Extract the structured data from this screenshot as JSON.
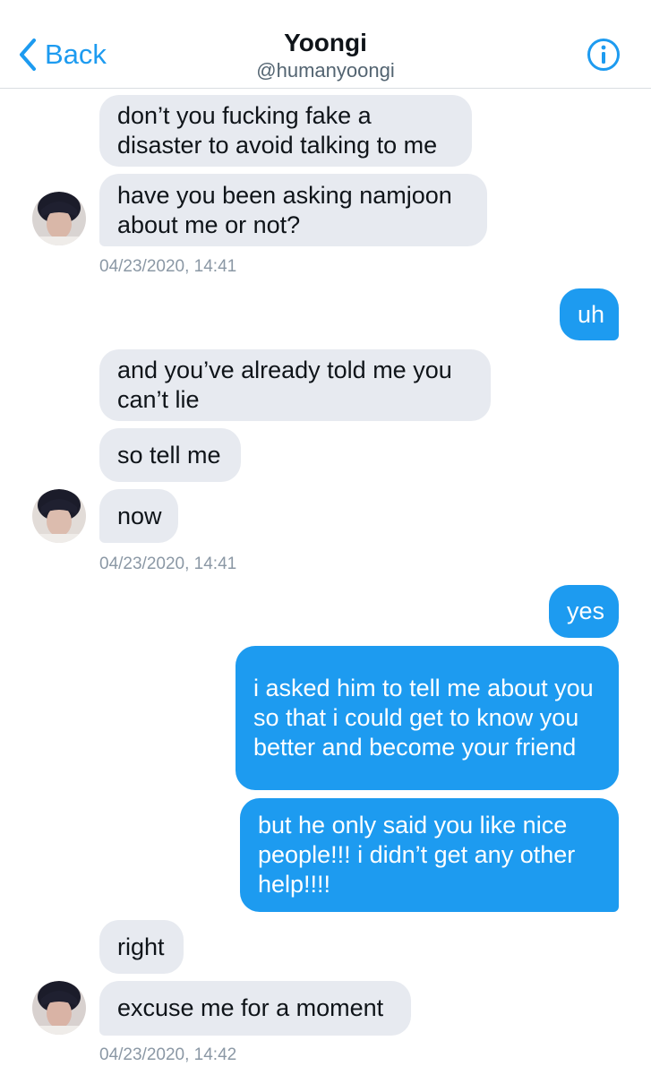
{
  "header": {
    "back_label": "Back",
    "title": "Yoongi",
    "handle": "@humanyoongi"
  },
  "messages": [
    {
      "sender": "them",
      "text": "don’t you fucking fake a disaster to avoid talking to me"
    },
    {
      "sender": "them",
      "text": "have you been asking namjoon about me or not?"
    },
    {
      "sender": "them",
      "timestamp": "04/23/2020, 14:41"
    },
    {
      "sender": "me",
      "text": "uh"
    },
    {
      "sender": "them",
      "text": "and you’ve already told me you can’t lie"
    },
    {
      "sender": "them",
      "text": "so tell me"
    },
    {
      "sender": "them",
      "text": "now"
    },
    {
      "sender": "them",
      "timestamp": "04/23/2020, 14:41"
    },
    {
      "sender": "me",
      "text": "yes"
    },
    {
      "sender": "me",
      "text": "i asked him to tell me about you so that i could get to know you better and become your friend"
    },
    {
      "sender": "me",
      "text": "but he only said you like nice people!!! i didn’t get any other help!!!!"
    },
    {
      "sender": "them",
      "text": "right"
    },
    {
      "sender": "them",
      "text": "excuse me for a moment"
    },
    {
      "sender": "them",
      "timestamp": "04/23/2020, 14:42"
    }
  ],
  "colors": {
    "accent": "#1d9bf0",
    "incoming_bubble": "#e7eaf0",
    "outgoing_bubble": "#1d9bf0",
    "timestamp": "#8b98a5"
  },
  "icons": [
    "chevron-left-icon",
    "info-icon",
    "avatar"
  ]
}
